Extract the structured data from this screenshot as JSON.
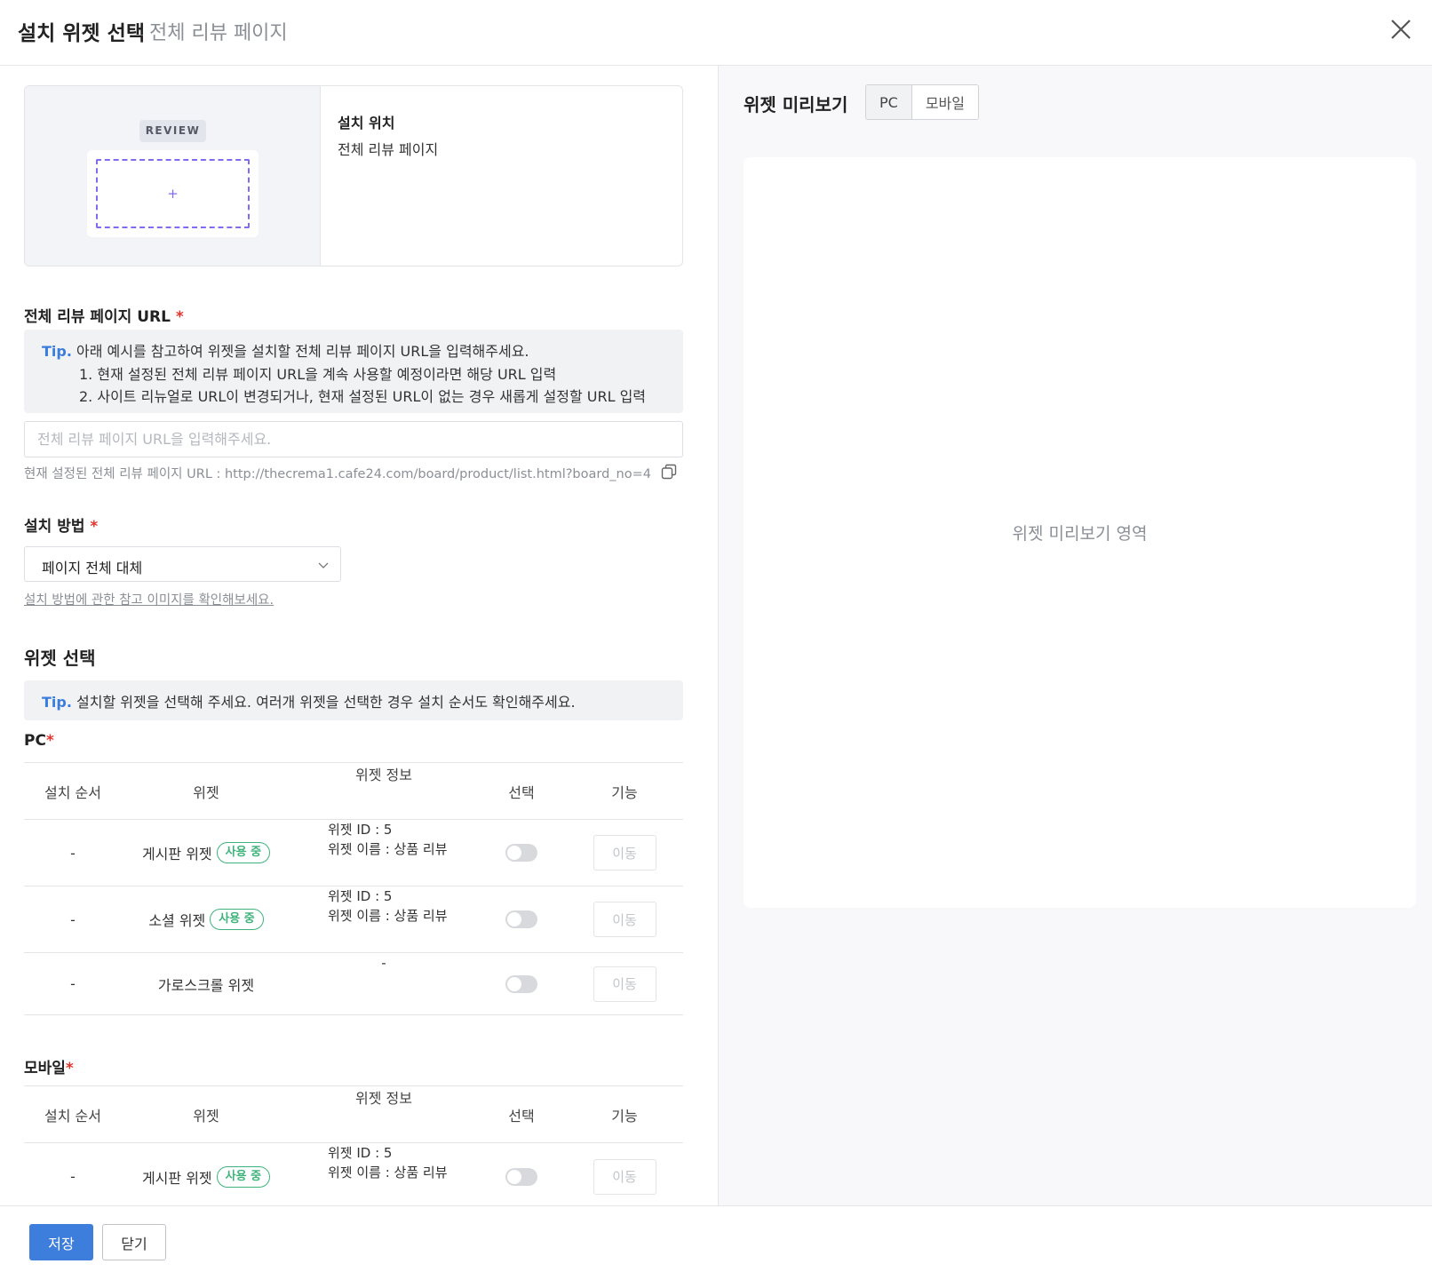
{
  "header": {
    "title": "설치 위젯 선택",
    "subtitle": "전체 리뷰 페이지"
  },
  "location": {
    "badge": "REVIEW",
    "plus": "+",
    "label": "설치 위치",
    "value": "전체 리뷰 페이지"
  },
  "url_section": {
    "label": "전체 리뷰 페이지 URL",
    "required": "*",
    "tip_label": "Tip.",
    "tip_line1": "아래 예시를 참고하여 위젯을 설치할 전체 리뷰 페이지 URL을 입력해주세요.",
    "tip_line2": "1. 현재 설정된 전체 리뷰 페이지 URL을 계속 사용할 예정이라면 해당 URL 입력",
    "tip_line3": "2. 사이트 리뉴얼로 URL이 변경되거나, 현재 설정된 URL이 없는 경우 새롭게 설정할 URL 입력",
    "input_value": "",
    "input_placeholder": "전체 리뷰 페이지 URL을 입력해주세요.",
    "current_url": "현재 설정된 전체 리뷰 페이지 URL : http://thecrema1.cafe24.com/board/product/list.html?board_no=4"
  },
  "method_section": {
    "label": "설치 방법",
    "required": "*",
    "selected": "페이지 전체 대체",
    "help_link": "설치 방법에 관한 참고 이미지를 확인해보세요."
  },
  "widget_section": {
    "title": "위젯 선택",
    "tip_label": "Tip.",
    "tip_text": "설치할 위젯을 선택해 주세요. 여러개 위젯을 선택한 경우 설치 순서도 확인해주세요."
  },
  "columns": {
    "order": "설치 순서",
    "widget": "위젯",
    "info": "위젯 정보",
    "select": "선택",
    "func": "기능"
  },
  "pc": {
    "label": "PC",
    "required": "*",
    "rows": [
      {
        "order": "-",
        "widget": "게시판 위젯",
        "badge": "사용 중",
        "info1": "위젯 ID : 5",
        "info2": "위젯 이름 : 상품 리뷰",
        "selected": false,
        "action": "이동"
      },
      {
        "order": "-",
        "widget": "소셜 위젯",
        "badge": "사용 중",
        "info1": "위젯 ID : 5",
        "info2": "위젯 이름 : 상품 리뷰",
        "selected": false,
        "action": "이동"
      },
      {
        "order": "-",
        "widget": "가로스크롤 위젯",
        "info_dash": "-",
        "selected": false,
        "action": "이동"
      }
    ]
  },
  "mobile": {
    "label": "모바일",
    "required": "*",
    "rows": [
      {
        "order": "-",
        "widget": "게시판 위젯",
        "badge": "사용 중",
        "info1": "위젯 ID : 5",
        "info2": "위젯 이름 : 상품 리뷰",
        "selected": false,
        "action": "이동"
      }
    ]
  },
  "preview": {
    "title": "위젯 미리보기",
    "tab_pc": "PC",
    "tab_mobile": "모바일",
    "active_tab": "PC",
    "placeholder": "위젯 미리보기 영역"
  },
  "footer": {
    "save": "저장",
    "close": "닫기"
  },
  "colors": {
    "accent": "#3d7ddc",
    "tip": "#3b7ddd",
    "badge_green": "#3fb37c",
    "required_red": "#e2342d",
    "dash_purple": "#7f6cf0"
  },
  "icons": [
    "close-icon",
    "copy-icon",
    "chevron-down-icon"
  ]
}
